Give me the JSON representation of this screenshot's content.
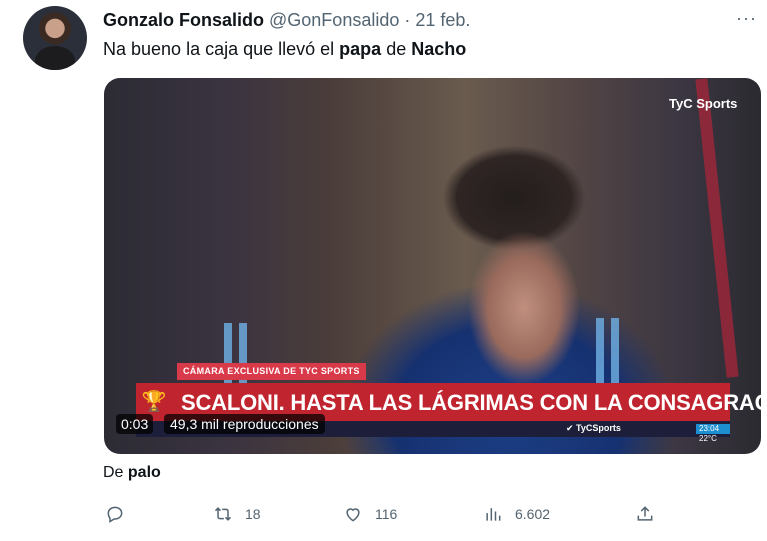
{
  "author": {
    "name": "Gonzalo Fonsalido",
    "handle": "@GonFonsalido",
    "separator": "·",
    "date": "21 feb."
  },
  "more_icon": "···",
  "tweet": {
    "part1": "Na bueno la caja que llevó el ",
    "bold1": "papa",
    "part2": " de ",
    "bold2": "Nacho"
  },
  "video": {
    "watermark": "TyC Sports",
    "kicker": "CÁMARA EXCLUSIVA DE TYC SPORTS",
    "headline": "SCALONI. HASTA LAS LÁGRIMAS CON LA CONSAGRACIÓN",
    "trophy_icon": "trophy-icon",
    "ticker_logo": "✔ TyCSports",
    "ticker_clock": "23:04  22°C",
    "duration": "0:03",
    "views": "49,3 mil reproducciones"
  },
  "reply": {
    "prefix": "De ",
    "bold": "palo"
  },
  "actions": {
    "reply_icon": "reply-icon",
    "retweet_icon": "retweet-icon",
    "retweets": "18",
    "like_icon": "heart-icon",
    "likes": "116",
    "views_icon": "analytics-icon",
    "views": "6.602",
    "share_icon": "share-icon"
  },
  "colors": {
    "text": "#0f1419",
    "secondary": "#536471",
    "lower_third": "#c0242f",
    "kicker": "#d93a4a"
  }
}
